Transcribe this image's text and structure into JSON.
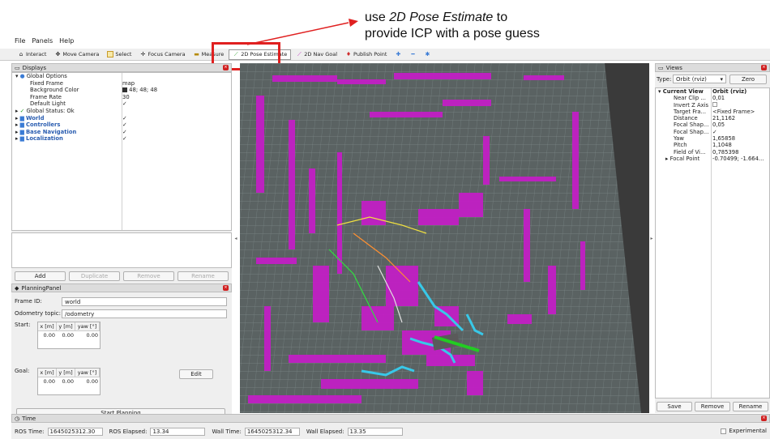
{
  "annotation": {
    "line1_pre": "use ",
    "line1_italic": "2D Pose Estimate",
    "line1_post": " to",
    "line2": "provide ICP with a pose guess"
  },
  "menu": {
    "file": "File",
    "panels": "Panels",
    "help": "Help"
  },
  "toolbar": {
    "interact": "Interact",
    "move_camera": "Move Camera",
    "select": "Select",
    "focus_camera": "Focus Camera",
    "measure": "Measure",
    "pose_estimate": "2D Pose Estimate",
    "nav_goal": "2D Nav Goal",
    "publish_point": "Publish Point"
  },
  "displays": {
    "title": "Displays",
    "rows": [
      {
        "label": "Global Options",
        "value": ""
      },
      {
        "label": "Fixed Frame",
        "value": "map"
      },
      {
        "label": "Background Color",
        "value": "48; 48; 48"
      },
      {
        "label": "Frame Rate",
        "value": "30"
      },
      {
        "label": "Default Light",
        "value": "✓"
      },
      {
        "label": "Global Status: Ok",
        "value": ""
      },
      {
        "label": "World",
        "value": "✓"
      },
      {
        "label": "Controllers",
        "value": "✓"
      },
      {
        "label": "Base Navigation",
        "value": "✓"
      },
      {
        "label": "Localization",
        "value": "✓"
      }
    ],
    "buttons": {
      "add": "Add",
      "duplicate": "Duplicate",
      "remove": "Remove",
      "rename": "Rename"
    }
  },
  "planning": {
    "title": "PlanningPanel",
    "frame_id_label": "Frame ID:",
    "frame_id": "world",
    "odom_label": "Odometry topic:",
    "odom": "/odometry",
    "start_label": "Start:",
    "goal_label": "Goal:",
    "col_x": "x [m]",
    "col_y": "y [m]",
    "col_yaw": "yaw [°]",
    "start": {
      "x": "0.00",
      "y": "0.00",
      "yaw": "0.00"
    },
    "goal": {
      "x": "0.00",
      "y": "0.00",
      "yaw": "0.00"
    },
    "edit": "Edit",
    "start_planning": "Start Planning"
  },
  "views": {
    "title": "Views",
    "type_label": "Type:",
    "type_value": "Orbit (rviz)",
    "zero": "Zero",
    "rows": [
      {
        "label": "Current View",
        "value": "Orbit (rviz)"
      },
      {
        "label": "Near Clip ...",
        "value": "0,01"
      },
      {
        "label": "Invert Z Axis",
        "value": ""
      },
      {
        "label": "Target Fra...",
        "value": "<Fixed Frame>"
      },
      {
        "label": "Distance",
        "value": "21,1162"
      },
      {
        "label": "Focal Shap...",
        "value": "0,05"
      },
      {
        "label": "Focal Shap...",
        "value": "✓"
      },
      {
        "label": "Yaw",
        "value": "1,65858"
      },
      {
        "label": "Pitch",
        "value": "1,1048"
      },
      {
        "label": "Field of Vi...",
        "value": "0,785398"
      },
      {
        "label": "Focal Point",
        "value": "-0.70499; -1.664..."
      }
    ],
    "save": "Save",
    "remove": "Remove",
    "rename": "Rename"
  },
  "time": {
    "title": "Time",
    "ros_time_label": "ROS Time:",
    "ros_time": "1645025312.30",
    "ros_elapsed_label": "ROS Elapsed:",
    "ros_elapsed": "13.34",
    "wall_time_label": "Wall Time:",
    "wall_time": "1645025312.34",
    "wall_elapsed_label": "Wall Elapsed:",
    "wall_elapsed": "13.35",
    "experimental": "Experimental"
  },
  "colors": {
    "accent": "#e02020",
    "map": "#c21fc4",
    "grid_bg": "#5a6262"
  }
}
